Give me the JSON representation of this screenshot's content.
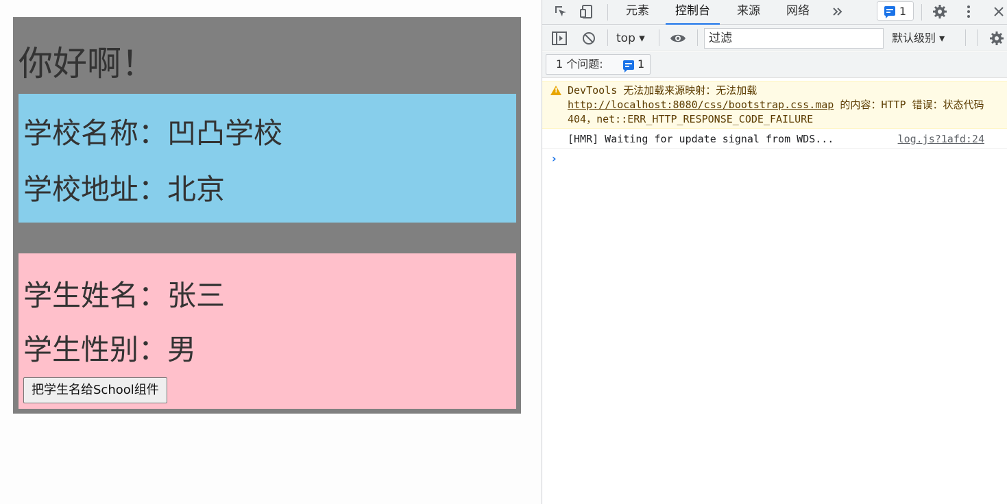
{
  "app": {
    "title": "你好啊！",
    "school": {
      "name_line": "学校名称：凹凸学校",
      "address_line": "学校地址：北京",
      "bg_color": "#87ceeb"
    },
    "student": {
      "name_line": "学生姓名：张三",
      "gender_line": "学生性别：男",
      "button_label": "把学生名给School组件",
      "bg_color": "#ffc0cb"
    },
    "bg_color": "#808080"
  },
  "devtools": {
    "tabs": [
      "元素",
      "控制台",
      "来源",
      "网络"
    ],
    "active_tab": "控制台",
    "issues_badge_count": "1",
    "context": "top",
    "filter_placeholder": "过滤",
    "level": "默认级别",
    "issues_label": "1 个问题:",
    "issues_count": "1",
    "messages": {
      "warning": {
        "prefix": "DevTools 无法加载来源映射：无法加载 ",
        "url": "http://localhost:8080/css/bootstrap.css.map",
        "suffix": " 的内容：HTTP 错误：状态代码 404，net::ERR_HTTP_RESPONSE_CODE_FAILURE"
      },
      "log": {
        "text": "[HMR] Waiting for update signal from WDS...",
        "source": "log.js?1afd:24"
      }
    },
    "prompt_symbol": "›",
    "icons": [
      "inspect-icon",
      "device-toolbar-icon",
      "more-tabs-icon",
      "settings-icon",
      "kebab-menu-icon",
      "close-icon",
      "sidebar-toggle-icon",
      "clear-console-icon",
      "eye-icon",
      "warning-icon"
    ],
    "accent_color": "#1a73e8"
  }
}
